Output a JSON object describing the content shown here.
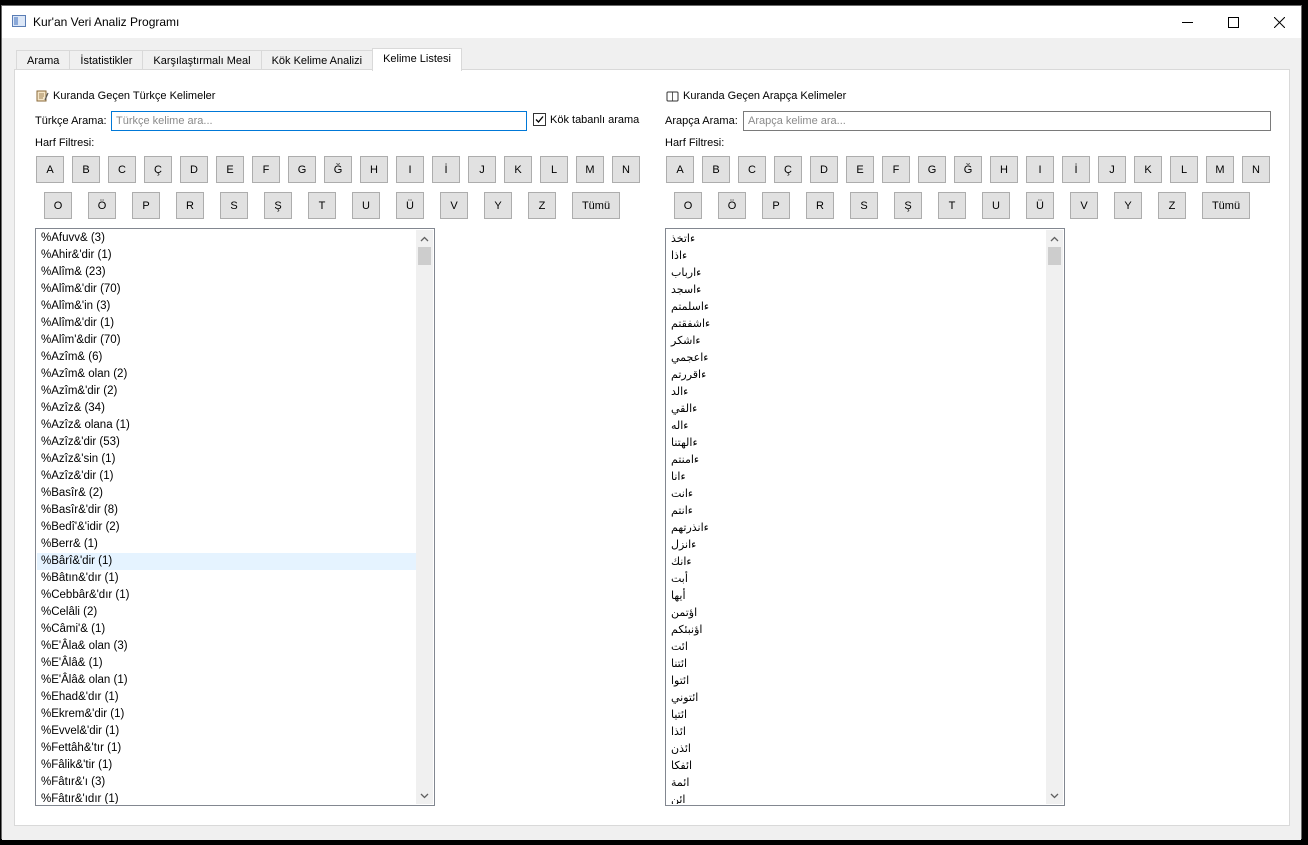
{
  "window": {
    "title": "Kur'an Veri Analiz Programı",
    "controls": {
      "minimize": "minimize-icon",
      "maximize": "maximize-icon",
      "close": "close-icon"
    }
  },
  "tabs": [
    {
      "label": "Arama",
      "active": false
    },
    {
      "label": "İstatistikler",
      "active": false
    },
    {
      "label": "Karşılaştırmalı Meal",
      "active": false
    },
    {
      "label": "Kök Kelime Analizi",
      "active": false
    },
    {
      "label": "Kelime Listesi",
      "active": true
    }
  ],
  "turkish": {
    "section_title": "Kuranda Geçen Türkçe Kelimeler",
    "section_icon": "scroll-icon",
    "search_label": "Türkçe Arama:",
    "search_value": "",
    "search_placeholder": "Türkçe kelime ara...",
    "root_search_label": "Kök tabanlı arama",
    "root_search_checked": true,
    "filter_label": "Harf Filtresi:",
    "letters_row1": [
      "A",
      "B",
      "C",
      "Ç",
      "D",
      "E",
      "F",
      "G",
      "Ğ",
      "H",
      "I",
      "İ",
      "J",
      "K",
      "L",
      "M",
      "N"
    ],
    "letters_row2": [
      "O",
      "Ö",
      "P",
      "R",
      "S",
      "Ş",
      "T",
      "U",
      "Ü",
      "V",
      "Y",
      "Z"
    ],
    "all_label": "Tümü",
    "selected_index": 19,
    "items": [
      "%Afuvv& (3)",
      "%Ahir&'dir (1)",
      "%Alîm& (23)",
      "%Alîm&'dir (70)",
      "%Alîm&'in (3)",
      "%Alîm&'dir (1)",
      "%Alîm'&dir (70)",
      "%Azîm& (6)",
      "%Azîm& olan (2)",
      "%Azîm&'dir (2)",
      "%Azîz& (34)",
      "%Azîz& olana (1)",
      "%Azîz&'dir (53)",
      "%Azîz&'sin (1)",
      "%Azîz&'dir (1)",
      "%Basîr& (2)",
      "%Basîr&'dir (8)",
      "%Bedî'&'idir (2)",
      "%Berr& (1)",
      "%Bârî&'dir (1)",
      "%Bâtın&'dır (1)",
      "%Cebbâr&'dır (1)",
      "%Celâli (2)",
      "%Câmi'& (1)",
      "%E'Âla& olan (3)",
      "%E'Âlâ& (1)",
      "%E'Âlâ& olan (1)",
      "%Ehad&'dır (1)",
      "%Ekrem&'dir (1)",
      "%Evvel&'dir (1)",
      "%Fettâh&'tır (1)",
      "%Fâlik&'tir (1)",
      "%Fâtır&'ı (3)",
      "%Fâtır&'ıdır (1)"
    ]
  },
  "arabic": {
    "section_title": "Kuranda Geçen Arapça Kelimeler",
    "section_icon": "book-icon",
    "search_label": "Arapça Arama:",
    "search_value": "",
    "search_placeholder": "Arapça kelime ara...",
    "filter_label": "Harf Filtresi:",
    "letters_row1": [
      "A",
      "B",
      "C",
      "Ç",
      "D",
      "E",
      "F",
      "G",
      "Ğ",
      "H",
      "I",
      "İ",
      "J",
      "K",
      "L",
      "M",
      "N"
    ],
    "letters_row2": [
      "O",
      "Ö",
      "P",
      "R",
      "S",
      "Ş",
      "T",
      "U",
      "Ü",
      "V",
      "Y",
      "Z"
    ],
    "all_label": "Tümü",
    "items": [
      "ءاتخذ",
      "ءاذا",
      "ءارباب",
      "ءاسجد",
      "ءاسلمتم",
      "ءاشفقتم",
      "ءاشكر",
      "ءاعجمي",
      "ءاقررتم",
      "ءالد",
      "ءالقي",
      "ءاله",
      "ءالهتنا",
      "ءامنتم",
      "ءانا",
      "ءانت",
      "ءانتم",
      "ءانذرتهم",
      "ءانزل",
      "ءانك",
      "أبت",
      "أيها",
      "اؤتمن",
      "اؤنبئكم",
      "ائت",
      "ائتنا",
      "ائتوا",
      "ائتوني",
      "ائتيا",
      "ائذا",
      "ائذن",
      "ائفكا",
      "ائمة",
      "ائن"
    ]
  }
}
